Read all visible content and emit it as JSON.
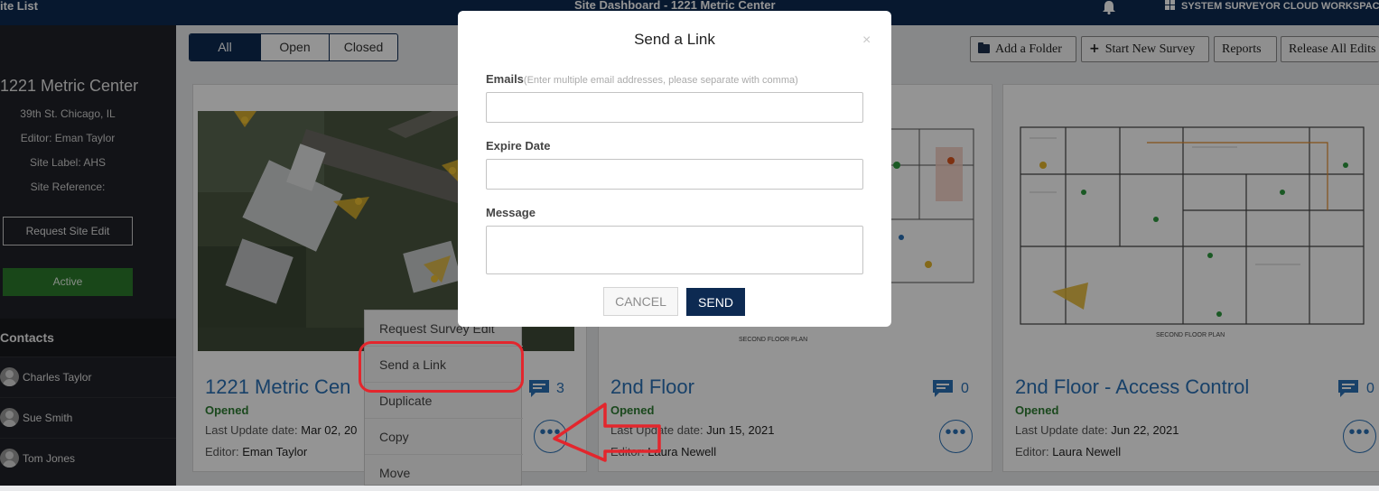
{
  "topbar": {
    "left_title": "ite List",
    "center_title": "Site Dashboard - 1221 Metric Center",
    "workspace": "SYSTEM SURVEYOR CLOUD WORKSPAC",
    "icons": [
      "bell-icon",
      "grid-icon"
    ]
  },
  "sidebar": {
    "site_name": "1221 Metric Center",
    "address": "39th St. Chicago, IL",
    "editor": "Editor: Eman Taylor",
    "site_label": "Site Label: AHS",
    "site_reference": "Site Reference:",
    "request_edit": "Request Site Edit",
    "status": "Active",
    "status_color": "#2b7a2b",
    "contacts_heading": "Contacts",
    "contacts": [
      "Charles Taylor",
      "Sue Smith",
      "Tom Jones"
    ]
  },
  "filters": {
    "tabs": [
      "All",
      "Open",
      "Closed"
    ],
    "selected": "All"
  },
  "toolbar": {
    "add_folder": "Add a Folder",
    "start_survey": "Start New Survey",
    "reports": "Reports",
    "release_edits": "Release All Edits"
  },
  "cards": [
    {
      "title": "1221 Metric Cen",
      "status": "Opened",
      "update_label": "Last Update date:",
      "update_value": "Mar 02, 20",
      "editor_label": "Editor:",
      "editor_value": "Eman Taylor",
      "comments": "3"
    },
    {
      "title": "2nd Floor",
      "status": "Opened",
      "update_label": "Last Update date:",
      "update_value": "Jun 15, 2021",
      "editor_label": "Editor:",
      "editor_value": "Laura Newell",
      "comments": "0"
    },
    {
      "title": "2nd Floor - Access Control",
      "status": "Opened",
      "update_label": "Last Update date:",
      "update_value": "Jun 22, 2021",
      "editor_label": "Editor:",
      "editor_value": "Laura Newell",
      "comments": "0"
    }
  ],
  "context_menu": [
    "Request Survey Edit",
    "Send a Link",
    "Duplicate",
    "Copy",
    "Move"
  ],
  "modal": {
    "title": "Send a Link",
    "close": "×",
    "emails_label": "Emails",
    "emails_hint": "(Enter multiple email addresses, please separate with comma)",
    "emails_value": "",
    "expire_label": "Expire Date",
    "expire_value": "",
    "message_label": "Message",
    "message_value": "",
    "cancel": "CANCEL",
    "send": "SEND"
  },
  "colors": {
    "navy": "#0d2a52",
    "link_blue": "#2a70b5",
    "status_green": "#2e7d32",
    "annotation_red": "#e3262d"
  }
}
